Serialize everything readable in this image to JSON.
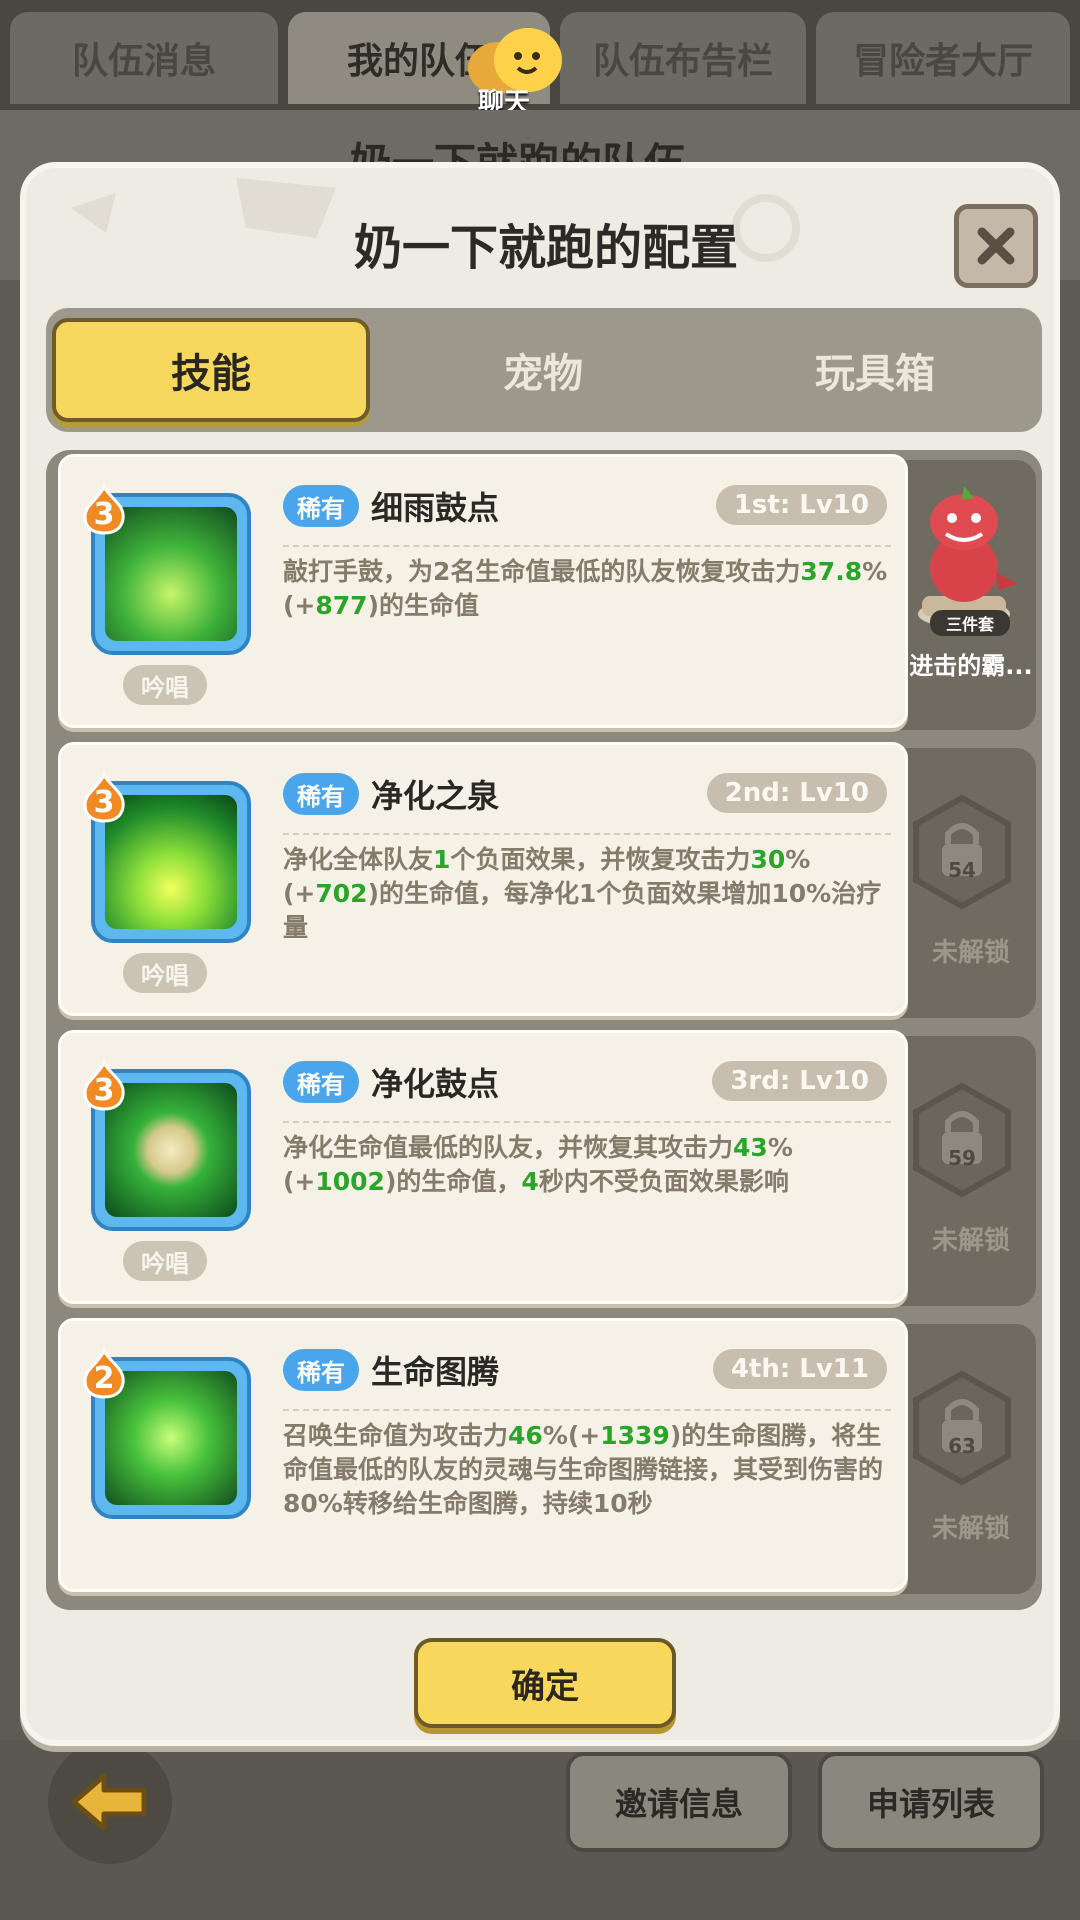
{
  "top_tabs": [
    "队伍消息",
    "我的队伍",
    "队伍布告栏",
    "冒险者大厅"
  ],
  "chat_label": "聊天",
  "background_title": "奶一下就跑的队伍",
  "modal": {
    "title": "奶一下就跑的配置",
    "tabs": [
      "技能",
      "宠物",
      "玩具箱"
    ],
    "active_tab": "技能",
    "confirm": "确定"
  },
  "skills": [
    {
      "level": "3",
      "rarity": "稀有",
      "name": "细雨鼓点",
      "slot": "1st: Lv10",
      "tag": "吟唱",
      "desc": [
        {
          "t": "敲打手鼓，为2名生命值最低的队友恢复攻击力",
          "g": false
        },
        {
          "t": "37.8",
          "g": true
        },
        {
          "t": "%(+",
          "g": false
        },
        {
          "t": "877",
          "g": true
        },
        {
          "t": ")的生命值",
          "g": false
        }
      ]
    },
    {
      "level": "3",
      "rarity": "稀有",
      "name": "净化之泉",
      "slot": "2nd: Lv10",
      "tag": "吟唱",
      "desc": [
        {
          "t": "净化全体队友",
          "g": false
        },
        {
          "t": "1",
          "g": true
        },
        {
          "t": "个负面效果，并恢复攻击力",
          "g": false
        },
        {
          "t": "30",
          "g": true
        },
        {
          "t": "%(+",
          "g": false
        },
        {
          "t": "702",
          "g": true
        },
        {
          "t": ")的生命值，每净化1个负面效果增加10%治疗量",
          "g": false
        }
      ]
    },
    {
      "level": "3",
      "rarity": "稀有",
      "name": "净化鼓点",
      "slot": "3rd: Lv10",
      "tag": "吟唱",
      "desc": [
        {
          "t": "净化生命值最低的队友，并恢复其攻击力",
          "g": false
        },
        {
          "t": "43",
          "g": true
        },
        {
          "t": "%(+",
          "g": false
        },
        {
          "t": "1002",
          "g": true
        },
        {
          "t": ")的生命值，",
          "g": false
        },
        {
          "t": "4",
          "g": true
        },
        {
          "t": "秒内不受负面效果影响",
          "g": false
        }
      ]
    },
    {
      "level": "2",
      "rarity": "稀有",
      "name": "生命图腾",
      "slot": "4th: Lv11",
      "tag": "",
      "desc": [
        {
          "t": "召唤生命值为攻击力",
          "g": false
        },
        {
          "t": "46",
          "g": true
        },
        {
          "t": "%(+",
          "g": false
        },
        {
          "t": "1339",
          "g": true
        },
        {
          "t": ")的生命图腾，将生命值最低的队友的灵魂与生命图腾链接，其受到伤害的80%转移给生命图腾，持续10秒",
          "g": false
        }
      ]
    }
  ],
  "side_slots": [
    {
      "type": "pet",
      "badge": "三件套",
      "label": "进击的霸..."
    },
    {
      "type": "locked",
      "level": "54",
      "label": "未解锁"
    },
    {
      "type": "locked",
      "level": "59",
      "label": "未解锁"
    },
    {
      "type": "locked",
      "level": "63",
      "label": "未解锁"
    }
  ],
  "bottom_buttons": [
    "邀请信息",
    "申请列表"
  ],
  "colors": {
    "accent_yellow": "#f7d85e",
    "rarity_blue": "#4aa6ec",
    "value_green": "#2aa52a"
  },
  "icons": [
    "back-arrow-icon",
    "close-icon",
    "lock-icon",
    "chat-bubble-icon",
    "level-flame-icon"
  ]
}
